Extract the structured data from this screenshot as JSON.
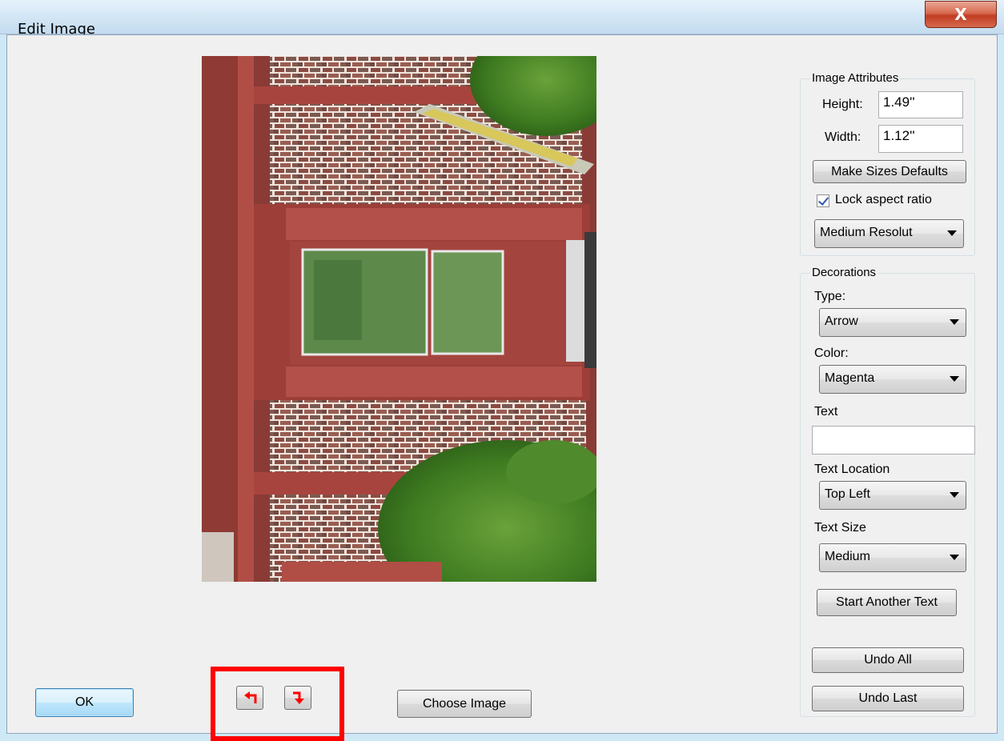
{
  "window": {
    "title": "Edit Image",
    "close_label": "X"
  },
  "image_attributes": {
    "group_label": "Image Attributes",
    "height_label": "Height:",
    "height_value": "1.49''",
    "width_label": "Width:",
    "width_value": "1.12''",
    "make_defaults_label": "Make Sizes Defaults",
    "lock_aspect_label": "Lock aspect ratio",
    "lock_aspect_checked": true,
    "resolution_value": "Medium Resolut"
  },
  "decorations": {
    "group_label": "Decorations",
    "type_label": "Type:",
    "type_value": "Arrow",
    "color_label": "Color:",
    "color_value": "Magenta",
    "text_label": "Text",
    "text_value": "",
    "text_location_label": "Text Location",
    "text_location_value": "Top Left",
    "text_size_label": "Text Size",
    "text_size_value": "Medium",
    "start_another_label": "Start Another Text",
    "undo_all_label": "Undo All",
    "undo_last_label": "Undo Last"
  },
  "footer": {
    "ok_label": "OK",
    "choose_image_label": "Choose Image"
  },
  "colors": {
    "highlight": "#ff0000",
    "rotate_arrow": "#ff0000"
  },
  "icons": {
    "rotate_left": "rotate-left-icon",
    "rotate_right": "rotate-right-icon"
  }
}
